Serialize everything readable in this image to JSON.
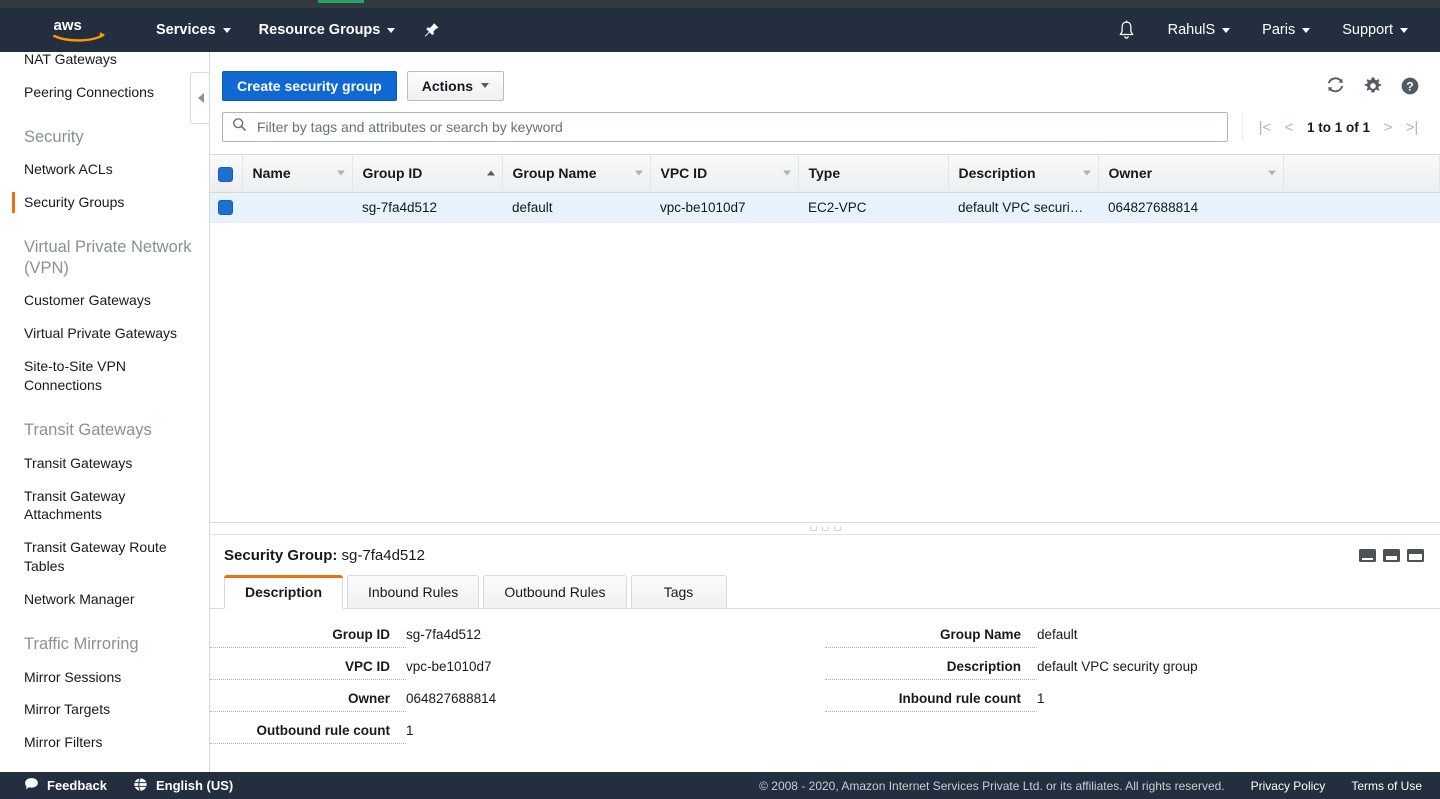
{
  "nav": {
    "logo_alt": "aws",
    "services_label": "Services",
    "resource_groups_label": "Resource Groups",
    "pin_icon": "pushpin-icon",
    "bell_icon": "bell-icon",
    "account_label": "RahulS",
    "region_label": "Paris",
    "support_label": "Support"
  },
  "sidebar": {
    "items": [
      {
        "label": "NAT Gateways",
        "type": "link",
        "active": false,
        "clipped": true
      },
      {
        "label": "Peering Connections",
        "type": "link",
        "active": false
      },
      {
        "label": "Security",
        "type": "header"
      },
      {
        "label": "Network ACLs",
        "type": "link",
        "active": false
      },
      {
        "label": "Security Groups",
        "type": "link",
        "active": true
      },
      {
        "label": "Virtual Private Network (VPN)",
        "type": "header"
      },
      {
        "label": "Customer Gateways",
        "type": "link",
        "active": false
      },
      {
        "label": "Virtual Private Gateways",
        "type": "link",
        "active": false
      },
      {
        "label": "Site-to-Site VPN Connections",
        "type": "link",
        "active": false
      },
      {
        "label": "Transit Gateways",
        "type": "header"
      },
      {
        "label": "Transit Gateways",
        "type": "link",
        "active": false
      },
      {
        "label": "Transit Gateway Attachments",
        "type": "link",
        "active": false
      },
      {
        "label": "Transit Gateway Route Tables",
        "type": "link",
        "active": false
      },
      {
        "label": "Network Manager",
        "type": "link",
        "active": false
      },
      {
        "label": "Traffic Mirroring",
        "type": "header"
      },
      {
        "label": "Mirror Sessions",
        "type": "link",
        "active": false
      },
      {
        "label": "Mirror Targets",
        "type": "link",
        "active": false
      },
      {
        "label": "Mirror Filters",
        "type": "link",
        "active": false
      }
    ],
    "collapse_icon": "chevron-left-icon",
    "active_accent_color": "#ec7211"
  },
  "toolbar": {
    "create_label": "Create security group",
    "actions_label": "Actions",
    "refresh_icon": "refresh-icon",
    "settings_icon": "gear-icon",
    "help_icon": "help-icon",
    "primary_color": "#1069d3"
  },
  "filter": {
    "placeholder": "Filter by tags and attributes or search by keyword",
    "value": "",
    "search_icon": "search-icon"
  },
  "pagination": {
    "first_icon": "first-page-icon",
    "prev_icon": "previous-page-icon",
    "count_label": "1 to 1 of 1",
    "next_icon": "next-page-icon",
    "last_icon": "last-page-icon"
  },
  "table": {
    "columns": [
      {
        "label": "Name",
        "sort": "none"
      },
      {
        "label": "Group ID",
        "sort": "asc"
      },
      {
        "label": "Group Name",
        "sort": "none"
      },
      {
        "label": "VPC ID",
        "sort": "none"
      },
      {
        "label": "Type",
        "sort": "hidden"
      },
      {
        "label": "Description",
        "sort": "none"
      },
      {
        "label": "Owner",
        "sort": "none"
      }
    ],
    "rows": [
      {
        "selected": true,
        "name": "",
        "group_id": "sg-7fa4d512",
        "group_name": "default",
        "vpc_id": "vpc-be1010d7",
        "type": "EC2-VPC",
        "description": "default VPC securi…",
        "owner": "064827688814"
      }
    ],
    "select_all_checked": true
  },
  "detail": {
    "title_label": "Security Group:",
    "title_value": "sg-7fa4d512",
    "panel_toggle_icons": [
      "panel-bottom-small-icon",
      "panel-bottom-medium-icon",
      "panel-bottom-large-icon"
    ],
    "tabs": [
      {
        "label": "Description",
        "active": true
      },
      {
        "label": "Inbound Rules",
        "active": false
      },
      {
        "label": "Outbound Rules",
        "active": false
      },
      {
        "label": "Tags",
        "active": false
      }
    ],
    "fields_left": [
      {
        "label": "Group ID",
        "value": "sg-7fa4d512"
      },
      {
        "label": "VPC ID",
        "value": "vpc-be1010d7"
      },
      {
        "label": "Owner",
        "value": "064827688814"
      },
      {
        "label": "Outbound rule count",
        "value": "1"
      }
    ],
    "fields_right": [
      {
        "label": "Group Name",
        "value": "default"
      },
      {
        "label": "Description",
        "value": "default VPC security group"
      },
      {
        "label": "Inbound rule count",
        "value": "1"
      }
    ]
  },
  "footer": {
    "feedback_label": "Feedback",
    "feedback_icon": "speech-bubble-icon",
    "language_label": "English (US)",
    "language_icon": "globe-icon",
    "copyright": "© 2008 - 2020, Amazon Internet Services Private Ltd. or its affiliates. All rights reserved.",
    "privacy_label": "Privacy Policy",
    "terms_label": "Terms of Use"
  }
}
